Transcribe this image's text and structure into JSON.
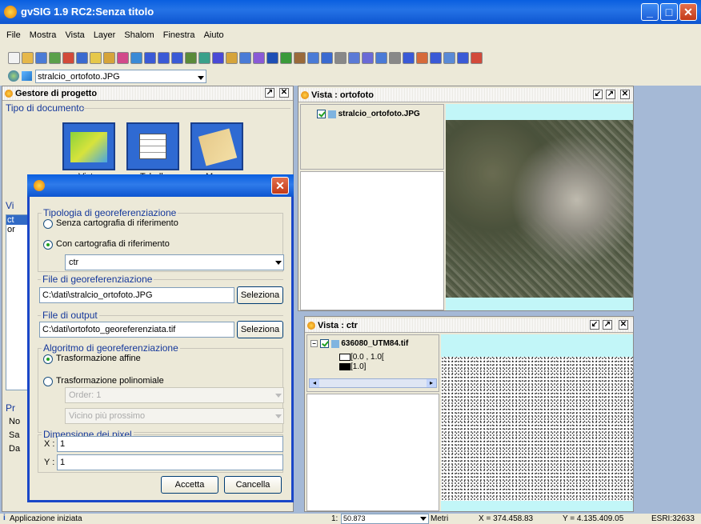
{
  "window": {
    "title": "gvSIG 1.9 RC2:Senza titolo"
  },
  "menu": [
    "File",
    "Mostra",
    "Vista",
    "Layer",
    "Shalom",
    "Finestra",
    "Aiuto"
  ],
  "layer_combo": {
    "value": "stralcio_ortofoto.JPG"
  },
  "project_manager": {
    "title": "Gestore di progetto",
    "doc_type_label": "Tipo di documento",
    "doc_labels": [
      "Vista",
      "Tabelle",
      "Mappa"
    ],
    "partial_letters": [
      "Vi",
      "Pr",
      "No",
      "Sa",
      "Da"
    ],
    "list_items": [
      "ct",
      "or"
    ]
  },
  "view_ortofoto": {
    "title": "Vista : ortofoto",
    "layer": "stralcio_ortofoto.JPG"
  },
  "view_ctr": {
    "title": "Vista : ctr",
    "layer": "636080_UTM84.tif",
    "legend": [
      "[0.0 , 1.0[",
      "[1.0]"
    ]
  },
  "dialog": {
    "group_type": {
      "label": "Tipologia di georeferenziazione",
      "opt1": "Senza cartografia di riferimento",
      "opt2": "Con cartografia di riferimento",
      "ref_value": "ctr"
    },
    "group_file": {
      "label": "File di georeferenziazione",
      "path": "C:\\dati\\stralcio_ortofoto.JPG",
      "button": "Seleziona"
    },
    "group_output": {
      "label": "File di output",
      "path": "C:\\dati\\ortofoto_georeferenziata.tif",
      "button": "Seleziona"
    },
    "group_algo": {
      "label": "Algoritmo di georeferenziazione",
      "opt1": "Trasformazione affine",
      "opt2": "Trasformazione polinomiale",
      "order": "Order: 1",
      "interp": "Vicino più prossimo"
    },
    "group_pixel": {
      "label": "Dimensione dei pixel",
      "x_label": "X :",
      "x_value": "1",
      "y_label": "Y :",
      "y_value": "1"
    },
    "accept": "Accetta",
    "cancel": "Cancella"
  },
  "status": {
    "message": "Applicazione iniziata",
    "scale_prefix": "1:",
    "scale": "50.873",
    "units": "Metri",
    "x": "X = 374.458.83",
    "y": "Y = 4.135.409.05",
    "crs": "ESRI:32633"
  },
  "colors": {
    "title_blue": "#0a5fe0",
    "desktop": "#a5b9d6",
    "group_label": "#15389b",
    "aqua": "#c2f6f8"
  }
}
